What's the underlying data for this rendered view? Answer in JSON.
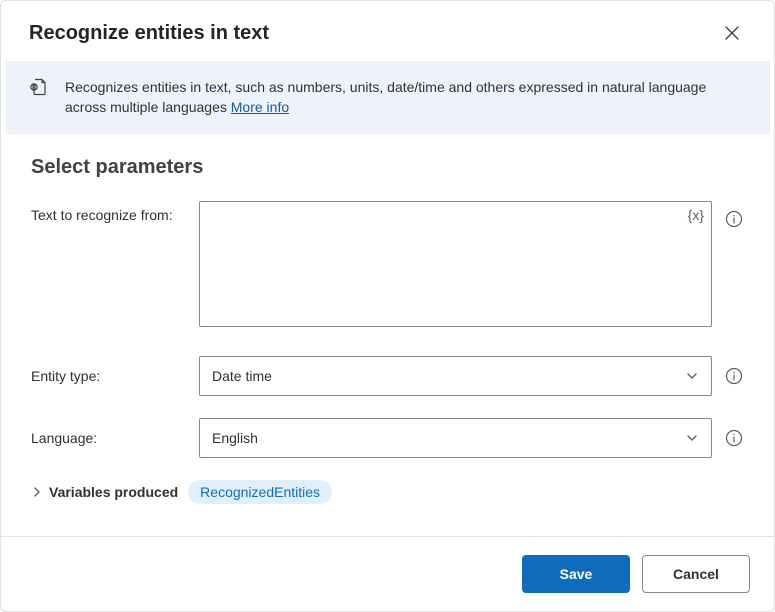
{
  "header": {
    "title": "Recognize entities in text"
  },
  "info": {
    "description": "Recognizes entities in text, such as numbers, units, date/time and others expressed in natural language across multiple languages ",
    "more_info_label": "More info"
  },
  "section": {
    "title": "Select parameters"
  },
  "params": {
    "text_label": "Text to recognize from:",
    "text_value": "",
    "variable_token_label": "{x}",
    "entity_type_label": "Entity type:",
    "entity_type_value": "Date time",
    "language_label": "Language:",
    "language_value": "English"
  },
  "variables": {
    "toggle_label": "Variables produced",
    "pill": "RecognizedEntities"
  },
  "footer": {
    "save_label": "Save",
    "cancel_label": "Cancel"
  }
}
